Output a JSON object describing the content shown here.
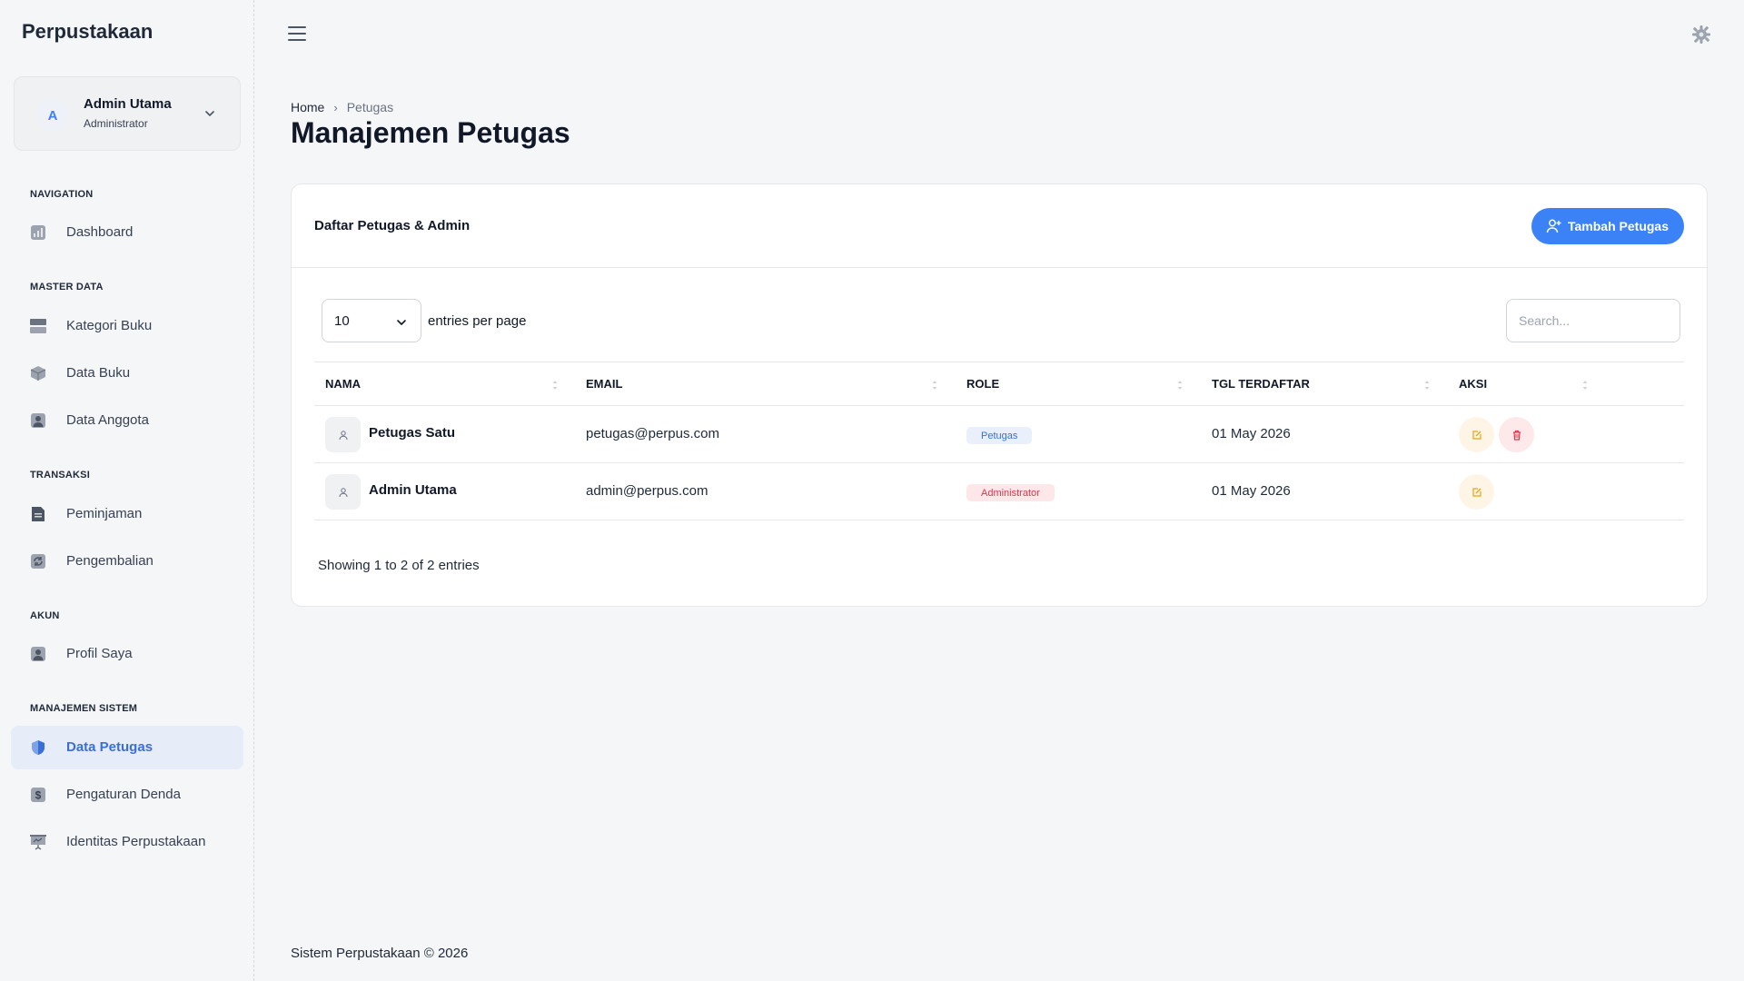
{
  "app": {
    "brand": "Perpustakaan"
  },
  "user": {
    "initial": "A",
    "name": "Admin Utama",
    "role": "Administrator"
  },
  "sidebar": {
    "sections": [
      {
        "title": "NAVIGATION"
      },
      {
        "title": "MASTER DATA"
      },
      {
        "title": "TRANSAKSI"
      },
      {
        "title": "AKUN"
      },
      {
        "title": "MANAJEMEN SISTEM"
      }
    ],
    "items": [
      {
        "label": "Dashboard",
        "icon": "chart-icon"
      },
      {
        "label": "Kategori Buku",
        "icon": "drawer-icon"
      },
      {
        "label": "Data Buku",
        "icon": "box-icon"
      },
      {
        "label": "Data Anggota",
        "icon": "user-card-icon"
      },
      {
        "label": "Peminjaman",
        "icon": "document-icon"
      },
      {
        "label": "Pengembalian",
        "icon": "refresh-icon"
      },
      {
        "label": "Profil Saya",
        "icon": "user-card-icon"
      },
      {
        "label": "Data Petugas",
        "icon": "shield-icon",
        "active": true
      },
      {
        "label": "Pengaturan Denda",
        "icon": "dollar-icon"
      },
      {
        "label": "Identitas Perpustakaan",
        "icon": "presentation-icon"
      }
    ]
  },
  "breadcrumb": {
    "home": "Home",
    "separator": "›",
    "current": "Petugas"
  },
  "page": {
    "title": "Manajemen Petugas"
  },
  "card": {
    "title": "Daftar Petugas & Admin",
    "add_button": "Tambah Petugas",
    "per_page_value": "10",
    "per_page_label": "entries per page",
    "search_placeholder": "Search..."
  },
  "table": {
    "columns": [
      "NAMA",
      "EMAIL",
      "ROLE",
      "TGL TERDAFTAR",
      "AKSI"
    ],
    "rows": [
      {
        "name": "Petugas Satu",
        "email": "petugas@perpus.com",
        "role": "Petugas",
        "date": "01 May 2026",
        "can_delete": true
      },
      {
        "name": "Admin Utama",
        "email": "admin@perpus.com",
        "role": "Administrator",
        "date": "01 May 2026",
        "can_delete": false
      }
    ],
    "showing": "Showing 1 to 2 of 2 entries"
  },
  "footer": {
    "text": "Sistem Perpustakaan © 2026"
  },
  "colors": {
    "accent": "#3b82f6",
    "active_bg": "#e6ecf8",
    "badge_admin": "#d33b4d",
    "badge_petugas": "#3b6fd8"
  }
}
